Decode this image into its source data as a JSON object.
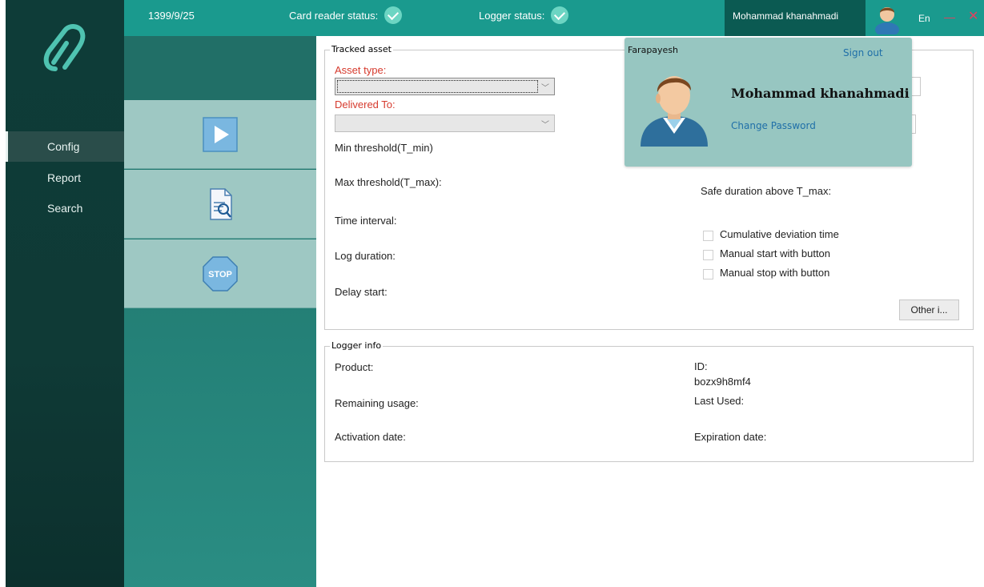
{
  "topbar": {
    "date": "1399/9/25",
    "card_reader_label": "Card reader status:",
    "logger_label": "Logger status:",
    "user_name": "Mohammad khanahmadi",
    "language": "En"
  },
  "sidebar": {
    "items": [
      {
        "label": "Config",
        "active": true
      },
      {
        "label": "Report",
        "active": false
      },
      {
        "label": "Search",
        "active": false
      }
    ]
  },
  "actions": {
    "play": "play-icon",
    "report": "document-search-icon",
    "stop_label": "STOP"
  },
  "tracked_asset": {
    "title": "Tracked asset",
    "asset_type_label": "Asset type:",
    "delivered_to_label": "Delivered To:",
    "min_threshold_label": "Min threshold(T_min)",
    "max_threshold_label": "Max threshold(T_max):",
    "time_interval_label": "Time interval:",
    "log_duration_label": "Log duration:",
    "delay_start_label": "Delay start:",
    "safe_duration_label": "Safe duration above T_max:",
    "cumulative_label": "Cumulative deviation time",
    "manual_start_label": "Manual start with button",
    "manual_stop_label": "Manual stop with button",
    "other_button": "Other i..."
  },
  "logger_info": {
    "title": "Logger info",
    "product_label": "Product:",
    "id_label": "ID:",
    "id_value": "bozx9h8mf4",
    "remaining_label": "Remaining usage:",
    "last_used_label": "Last Used:",
    "activation_label": "Activation date:",
    "expiration_label": "Expiration date:"
  },
  "popup": {
    "brand": "Farapayesh",
    "sign_out": "Sign out",
    "name": "Mohammad khanahmadi",
    "change_password": "Change Password"
  },
  "colors": {
    "topbar": "#1a9a8e",
    "sidebar": "#0e3c38",
    "action_button": "#9ec8c3",
    "popup": "#97c6c1",
    "required_label": "#d63a2d",
    "link": "#1f6fa8"
  }
}
